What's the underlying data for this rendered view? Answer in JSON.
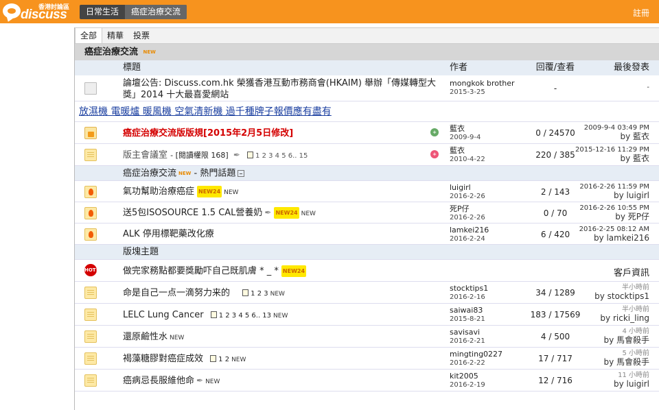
{
  "header": {
    "logo_text": "discuss",
    "logo_hk": "香港討論區",
    "tabs": [
      "日常生活",
      "癌症治療交流"
    ],
    "register": "註冊"
  },
  "filters": [
    "全部",
    "精華",
    "投票"
  ],
  "forum": {
    "title": "癌症治療交流",
    "new_tag": "NEW"
  },
  "columns": {
    "title": "標題",
    "author": "作者",
    "stats": "回覆/查看",
    "last": "最後發表"
  },
  "announcement": {
    "title": "論壇公告: Discuss.com.hk 榮獲香港互動市務商會(HKAIM) 舉辦「傳媒轉型大獎」2014 十大最喜愛網站",
    "author": "mongkok brother",
    "date": "2015-3-25",
    "stats": "-",
    "last": "-"
  },
  "ad_link": "放濕機 電暖爐 暖風機 空氣清新機 過千種牌子報價應有盡有",
  "pinned": [
    {
      "title": "癌症治療交流版版規[2015年2月5日修改]",
      "author": "藍衣",
      "date": "2009-9-4",
      "stats": "0 / 24570",
      "last_time": "2009-9-4 03:49 PM",
      "last_by": "by 藍衣"
    },
    {
      "title": "版主會議室",
      "perm": "- [閱讀權限 168]",
      "pages": "1 2 3 4 5 6.. 15",
      "author": "藍衣",
      "date": "2010-4-22",
      "stats": "220 / 385",
      "last_time": "2015-12-16 11:29 PM",
      "last_by": "by 藍衣"
    }
  ],
  "hot_section": {
    "label": "癌症治療交流",
    "suffix": "- 熱門話題"
  },
  "hot_topics": [
    {
      "title": "氣功幫助治療癌症",
      "author": "luigirl",
      "date": "2016-2-26",
      "stats": "2 / 143",
      "last_time": "2016-2-26 11:59 PM",
      "last_by": "by luigirl"
    },
    {
      "title": "送5包ISOSOURCE 1.5 CAL營養奶",
      "author": "死P仔",
      "date": "2016-2-26",
      "stats": "0 / 70",
      "last_time": "2016-2-26 10:55 PM",
      "last_by": "by 死P仔"
    },
    {
      "title": "ALK 停用標靶藥改化療",
      "author": "lamkei216",
      "date": "2016-2-24",
      "stats": "6 / 420",
      "last_time": "2016-2-25 08:12 AM",
      "last_by": "by lamkei216"
    }
  ],
  "board_section": "版塊主題",
  "sponsored": {
    "badge": "HOT!",
    "title": "做完家務點都要獎勵吓自己既肌膚 * _ *",
    "right": "客戶資訊"
  },
  "threads": [
    {
      "title": "命是自己一点一滴努力来的",
      "pages": "1 2 3",
      "author": "stocktips1",
      "date": "2016-2-16",
      "stats": "34 / 1289",
      "last_time": "半小時前",
      "last_by": "by stocktips1"
    },
    {
      "title": "LELC Lung Cancer",
      "pages": "1 2 3 4 5 6.. 13",
      "author": "saiwai83",
      "date": "2015-8-21",
      "stats": "183 / 17569",
      "last_time": "半小時前",
      "last_by": "by ricki_ling"
    },
    {
      "title": "還原鹼性水",
      "pages": "",
      "author": "savisavi",
      "date": "2016-2-21",
      "stats": "4 / 500",
      "last_time": "4 小時前",
      "last_by": "by 馬會殺手"
    },
    {
      "title": "褐藻糖膠對癌症成效",
      "pages": "1 2",
      "author": "mingting0227",
      "date": "2016-2-22",
      "stats": "17 / 717",
      "last_time": "5 小時前",
      "last_by": "by 馬會殺手"
    },
    {
      "title": "癌病忌長服維他命",
      "pages": "",
      "author": "kit2005",
      "date": "2016-2-19",
      "stats": "12 / 716",
      "last_time": "11 小時前",
      "last_by": "by luigirl"
    }
  ],
  "labels": {
    "new": "NEW",
    "new24": "NEW24"
  },
  "colors": {
    "topbar": "#f7931e",
    "pinned_red": "#d40000",
    "link_blue": "#1b3fa0"
  }
}
